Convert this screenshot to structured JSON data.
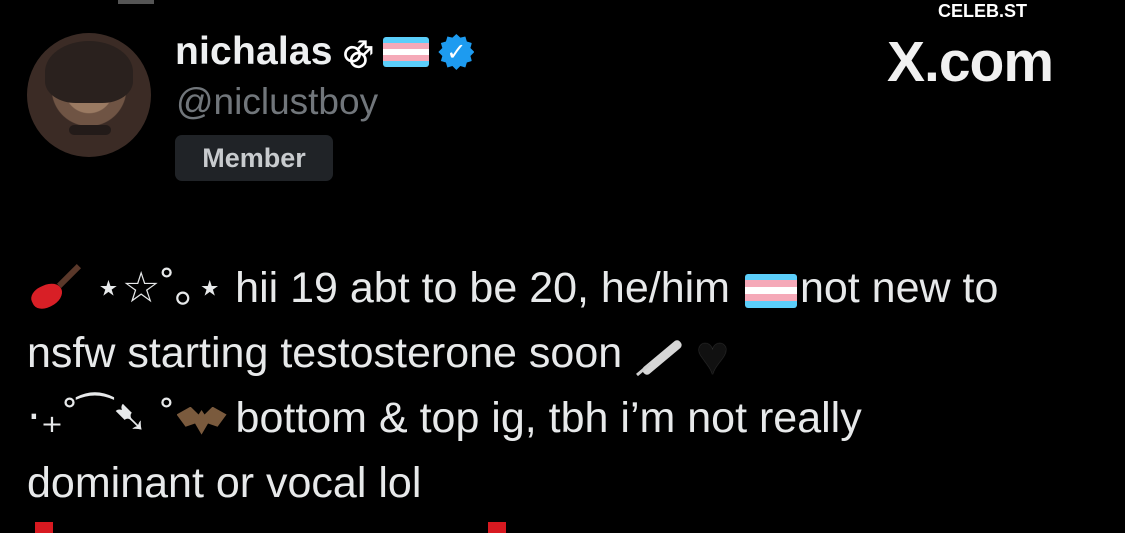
{
  "profile": {
    "display_name": "nichalas",
    "gender_symbol": "⚣",
    "handle": "@niclustboy",
    "badge": "Member"
  },
  "site": {
    "watermark": "CELEB.ST",
    "brand": "X.com"
  },
  "bio": {
    "line1_prefix": "⋆☆˚｡⋆ hii 19 abt to be 20, he/him",
    "line1_suffix": "not new to",
    "line2": "nsfw starting testosterone soon",
    "line3_prefix": "‧₊˚⁀➷ ˚",
    "line3_suffix": "bottom & top ig, tbh i’m not really",
    "line4": "dominant or vocal lol"
  },
  "colors": {
    "verified": "#1d9bf0",
    "trans_flag": [
      "#5bcefa",
      "#f5a9b8",
      "#ffffff",
      "#f5a9b8",
      "#5bcefa"
    ]
  },
  "icons": {
    "verified": "verified-badge-icon",
    "guitar": "electric-guitar-icon",
    "syringe": "syringe-icon",
    "heart": "black-heart-icon",
    "bat": "bat-icon"
  }
}
